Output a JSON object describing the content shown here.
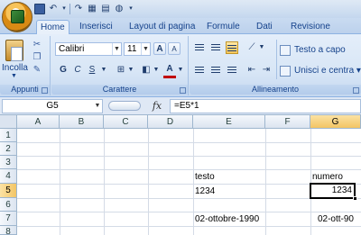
{
  "app": {
    "tabs": [
      "Home",
      "Inserisci",
      "Layout di pagina",
      "Formule",
      "Dati",
      "Revisione"
    ],
    "active_tab": "Home"
  },
  "ribbon": {
    "clipboard": {
      "paste_label": "Incolla",
      "group_label": "Appunti"
    },
    "font": {
      "font_name": "Calibri",
      "font_size": "11",
      "grow": "A",
      "shrink": "A",
      "bold": "G",
      "italic": "C",
      "underline": "S",
      "font_color_glyph": "A",
      "group_label": "Carattere",
      "font_color": "#c00000"
    },
    "alignment": {
      "wrap_text_label": "Testo a capo",
      "merge_center_label": "Unisci e centra",
      "merge_dropdown": "▾",
      "group_label": "Allineamento"
    }
  },
  "formula_bar": {
    "name_box": "G5",
    "fx": "fx",
    "formula": "=E5*1"
  },
  "sheet": {
    "columns": [
      "A",
      "B",
      "C",
      "D",
      "E",
      "F",
      "G"
    ],
    "rows": [
      "1",
      "2",
      "3",
      "4",
      "5",
      "6",
      "7",
      "8"
    ],
    "selected_column": "G",
    "selected_row": "5",
    "cells": {
      "E4": "testo",
      "G4": "numero",
      "E5": "1234",
      "G5": "1234",
      "E7": "02-ottobre-1990",
      "G7": "02-ott-90"
    }
  }
}
